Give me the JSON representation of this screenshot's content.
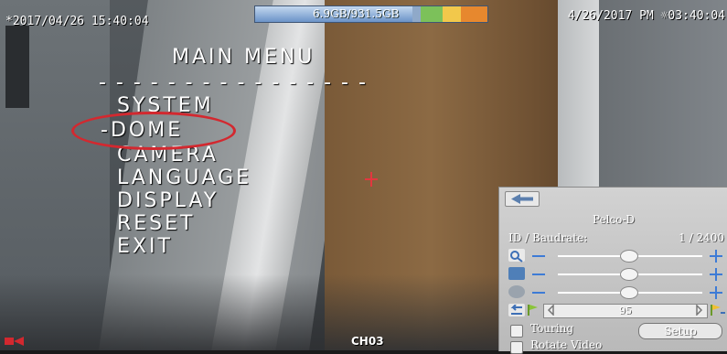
{
  "osd": {
    "timestamp_left": "*2017/04/26 15:40:04",
    "timestamp_right": "4/26/2017 PM ☼03:40:04",
    "hdd_usage": "6.9GB/931.5GB",
    "channel": "CH03"
  },
  "menu": {
    "title": "MAIN MENU",
    "separator": "- - - - - - - - - - - - - - - -",
    "items": [
      "SYSTEM",
      "DOME",
      "CAMERA",
      "LANGUAGE",
      "DISPLAY",
      "RESET",
      "EXIT"
    ],
    "selected_marker": "-"
  },
  "ptz": {
    "protocol": "Pelco-D",
    "id_baud_label": "ID / Baudrate:",
    "id_baud_value": "1 / 2400",
    "speed": "95",
    "touring_label": "Touring",
    "setup_label": "Setup",
    "rotate_label": "Rotate Video"
  },
  "colors": {
    "highlight_circle": "#d3282f",
    "hdd_used": "#6b93c8"
  }
}
